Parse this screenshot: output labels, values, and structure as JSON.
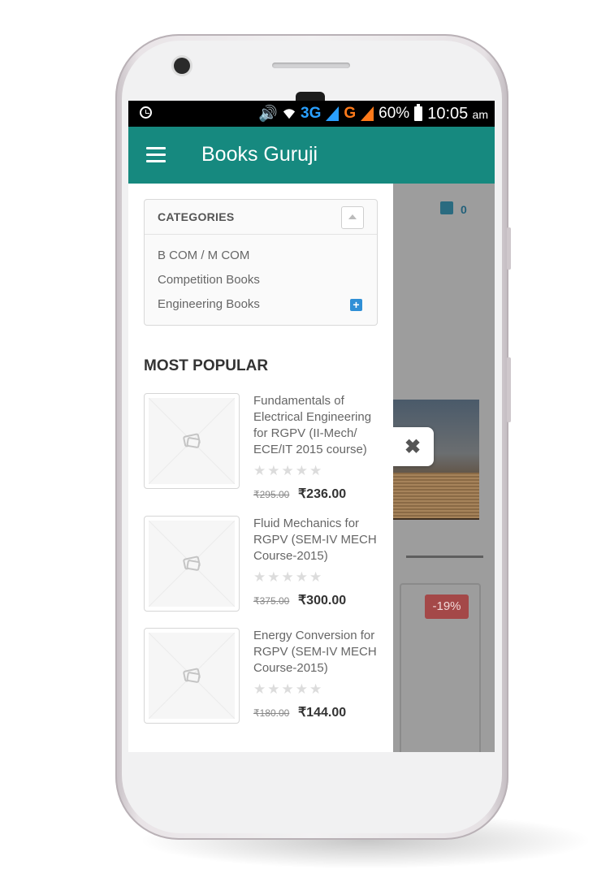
{
  "statusbar": {
    "network_3g": "3G",
    "network_g": "G",
    "battery": "60%",
    "time": "10:05",
    "ampm": "am"
  },
  "appbar": {
    "title": "Books Guruji"
  },
  "background_page": {
    "cart_count": "0",
    "discount_badge": "-19%"
  },
  "categories": {
    "title": "CATEGORIES",
    "items": [
      {
        "label": "B COM / M COM"
      },
      {
        "label": "Competition Books"
      },
      {
        "label": "Engineering Books"
      }
    ]
  },
  "most_popular": {
    "title": "MOST POPULAR",
    "products": [
      {
        "name": "Fundamentals of Electrical Engineering for RGPV (II-Mech/ ECE/IT 2015 course)",
        "rating": 0,
        "stars": "★★★★★",
        "old_price": "₹295.00",
        "price": "₹236.00"
      },
      {
        "name": "Fluid Mechanics for RGPV (SEM-IV MECH Course-2015)",
        "rating": 0,
        "stars": "★★★★★",
        "old_price": "₹375.00",
        "price": "₹300.00"
      },
      {
        "name": "Energy Conversion for RGPV (SEM-IV MECH Course-2015)",
        "rating": 0,
        "stars": "★★★★★",
        "old_price": "₹180.00",
        "price": "₹144.00"
      }
    ]
  },
  "colors": {
    "appbar": "#16897f",
    "statusbar": "#000000",
    "overlay": "#9d9d9d",
    "plus_button": "#2f8fd6",
    "discount_badge": "#a44848"
  },
  "icons": {
    "menu": "hamburger-menu-icon",
    "close": "close-icon",
    "cart": "shopping-bag-icon",
    "collapse": "chevron-up-icon",
    "expand": "plus-square-icon",
    "placeholder": "image-placeholder-icon"
  }
}
